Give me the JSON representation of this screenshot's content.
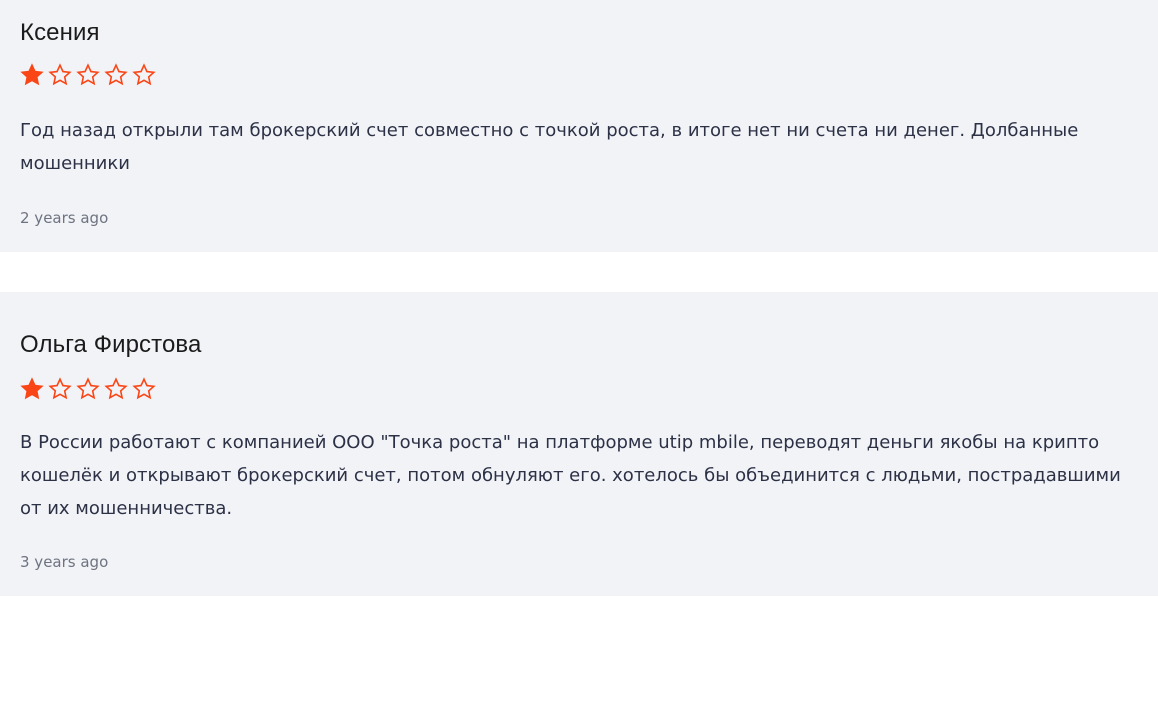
{
  "page": {
    "background": "#ffffff",
    "card_background": "#f2f3f7",
    "star_color": "#fa4616",
    "heading_color": "#1b1b1b",
    "body_color": "#2c3146",
    "timestamp_color": "#6d7380"
  },
  "reviews": [
    {
      "author": "Ксения",
      "rating": 1,
      "max_rating": 5,
      "text": "Год назад открыли там брокерский счет совместно с точкой роста, в итоге нет ни счета ни денег. Долбанные мошенники",
      "time": "2 years ago"
    },
    {
      "author": "Ольга Фирстова",
      "rating": 1,
      "max_rating": 5,
      "text": "В России работают с компанией ООО \"Точка роста\" на платформе utip mbile, переводят деньги якобы на крипто кошелёк и открывают брокерский счет, потом обнуляют его. хотелось бы объединится с людьми, пострадавшими от их мошенничества.",
      "time": "3 years ago"
    }
  ]
}
